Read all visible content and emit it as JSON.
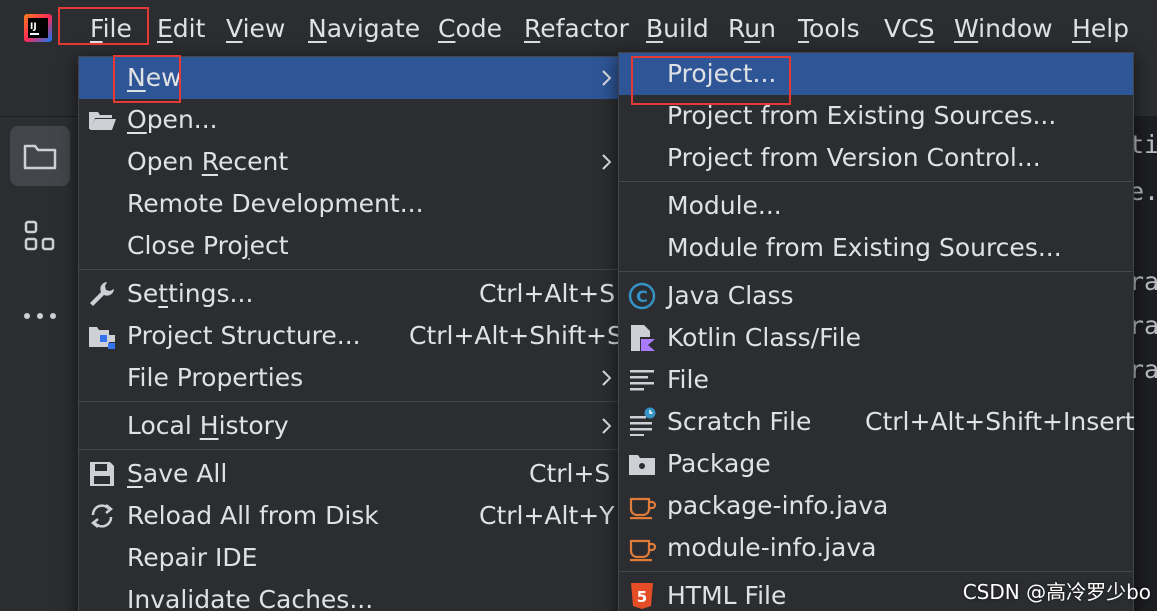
{
  "menubar": {
    "items": [
      {
        "pre": "",
        "u": "F",
        "post": "ile"
      },
      {
        "pre": "",
        "u": "E",
        "post": "dit"
      },
      {
        "pre": "",
        "u": "V",
        "post": "iew"
      },
      {
        "pre": "",
        "u": "N",
        "post": "avigate"
      },
      {
        "pre": "",
        "u": "C",
        "post": "ode"
      },
      {
        "pre": "",
        "u": "R",
        "post": "efactor"
      },
      {
        "pre": "",
        "u": "B",
        "post": "uild"
      },
      {
        "pre": "R",
        "u": "u",
        "post": "n"
      },
      {
        "pre": "",
        "u": "T",
        "post": "ools"
      },
      {
        "pre": "VC",
        "u": "S",
        "post": ""
      },
      {
        "pre": "",
        "u": "W",
        "post": "indow"
      },
      {
        "pre": "",
        "u": "H",
        "post": "elp"
      }
    ]
  },
  "file_menu": {
    "items": [
      {
        "pre": "",
        "u": "N",
        "post": "ew",
        "shortcut": ""
      },
      {
        "pre": "",
        "u": "O",
        "post": "pen...",
        "shortcut": ""
      },
      {
        "pre": "Open ",
        "u": "R",
        "post": "ecent",
        "shortcut": ""
      },
      {
        "pre": "Remote Development...",
        "u": "",
        "post": "",
        "shortcut": ""
      },
      {
        "pre": "Close Pro",
        "u": "j",
        "post": "ect",
        "shortcut": ""
      },
      {
        "pre": "Se",
        "u": "t",
        "post": "tings...",
        "shortcut": "Ctrl+Alt+S"
      },
      {
        "pre": "Project Structure...",
        "u": "",
        "post": "",
        "shortcut": "Ctrl+Alt+Shift+S"
      },
      {
        "pre": "File Properties",
        "u": "",
        "post": "",
        "shortcut": ""
      },
      {
        "pre": "Local ",
        "u": "H",
        "post": "istory",
        "shortcut": ""
      },
      {
        "pre": "",
        "u": "S",
        "post": "ave All",
        "shortcut": "Ctrl+S"
      },
      {
        "pre": "Reload All from Disk",
        "u": "",
        "post": "",
        "shortcut": "Ctrl+Alt+Y"
      },
      {
        "pre": "Repair IDE",
        "u": "",
        "post": "",
        "shortcut": ""
      },
      {
        "pre": "Invalidate Caches...",
        "u": "",
        "post": "",
        "shortcut": ""
      }
    ]
  },
  "new_menu": {
    "items": [
      {
        "label": "Project...",
        "shortcut": ""
      },
      {
        "label": "Project from Existing Sources...",
        "shortcut": ""
      },
      {
        "label": "Project from Version Control...",
        "shortcut": ""
      },
      {
        "label": "Module...",
        "shortcut": ""
      },
      {
        "label": "Module from Existing Sources...",
        "shortcut": ""
      },
      {
        "label": "Java Class",
        "shortcut": ""
      },
      {
        "label": "Kotlin Class/File",
        "shortcut": ""
      },
      {
        "label": "File",
        "shortcut": ""
      },
      {
        "label": "Scratch File",
        "shortcut": "Ctrl+Alt+Shift+Insert"
      },
      {
        "label": "Package",
        "shortcut": ""
      },
      {
        "label": "package-info.java",
        "shortcut": ""
      },
      {
        "label": "module-info.java",
        "shortcut": ""
      },
      {
        "label": "HTML File",
        "shortcut": ""
      }
    ]
  },
  "editor": {
    "fragments": [
      "tie",
      "e.",
      "ra",
      "ra",
      "ra"
    ]
  },
  "watermark": "CSDN @高冷罗少bo",
  "colors": {
    "background": "#2b2d30",
    "editor_background": "#1e1f22",
    "selection": "#2e5596",
    "annotation": "#e53935",
    "java_class_icon": "#3592c4",
    "kotlin_icon": "#a97bff",
    "html_icon": "#e44d26",
    "java_file_icon": "#e07b3a"
  },
  "icons": {
    "logo": "intellij-idea-logo",
    "stripe": [
      "project-folder-icon",
      "structure-icon",
      "more-icon"
    ]
  }
}
